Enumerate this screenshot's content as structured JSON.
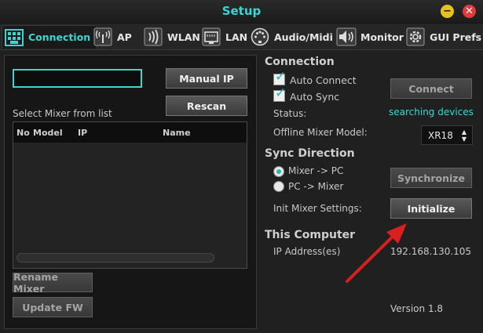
{
  "window": {
    "title": "Setup",
    "minimize_icon": "minimize-icon",
    "close_icon": "close-icon"
  },
  "tabs": [
    {
      "label": "Connection",
      "icon": "network-grid-icon",
      "active": true
    },
    {
      "label": "AP",
      "icon": "wireless-antenna-icon",
      "active": false
    },
    {
      "label": "WLAN",
      "icon": "wifi-waves-icon",
      "active": false
    },
    {
      "label": "LAN",
      "icon": "ethernet-port-icon",
      "active": false
    },
    {
      "label": "Audio/Midi",
      "icon": "midi-port-icon",
      "active": false
    },
    {
      "label": "Monitor",
      "icon": "speaker-icon",
      "active": false
    },
    {
      "label": "GUI Prefs",
      "icon": "gear-icon",
      "active": false
    }
  ],
  "left_panel": {
    "search_value": "",
    "manual_ip_label": "Manual IP",
    "rescan_label": "Rescan",
    "select_mixer_label": "Select Mixer from list",
    "table_columns": [
      "No",
      "Model",
      "IP",
      "Name"
    ],
    "table_rows": [],
    "rename_mixer_label": "Rename Mixer",
    "update_fw_label": "Update FW"
  },
  "connection": {
    "heading": "Connection",
    "auto_connect_label": "Auto Connect",
    "auto_connect_checked": true,
    "auto_sync_label": "Auto Sync",
    "auto_sync_checked": true,
    "status_label": "Status:",
    "status_value": "searching devices",
    "offline_model_label": "Offline Mixer Model:",
    "offline_model_value": "XR18",
    "connect_label": "Connect"
  },
  "sync": {
    "heading": "Sync Direction",
    "option_mixer_to_pc": "Mixer -> PC",
    "option_pc_to_mixer": "PC -> Mixer",
    "selected": "Mixer -> PC",
    "synchronize_label": "Synchronize",
    "init_label": "Init Mixer Settings:",
    "initialize_label": "Initialize"
  },
  "this_computer": {
    "heading": "This Computer",
    "ip_label": "IP Address(es)",
    "ip_value": "192.168.130.105"
  },
  "version": "Version 1.8",
  "colors": {
    "accent": "#3ad6d2",
    "annotation_arrow": "#d8201f",
    "minimize": "#e7c21c",
    "close": "#e23a3a"
  }
}
